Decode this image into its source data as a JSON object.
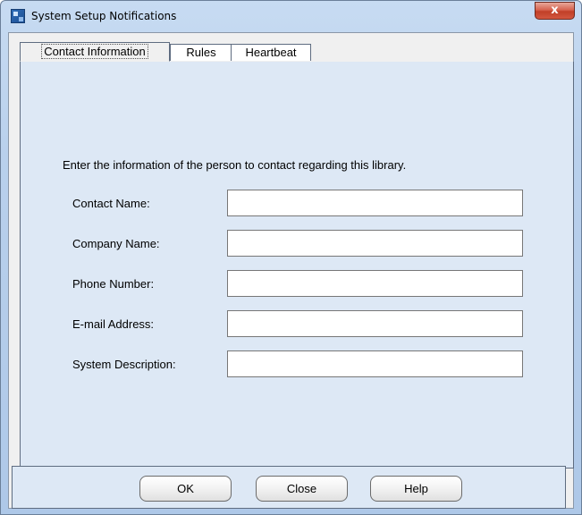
{
  "window": {
    "title": "System Setup Notifications",
    "close_glyph": "x",
    "icon": "app-icon",
    "colors": {
      "frame": "#b9d0ec",
      "panel": "#dde8f5",
      "close_button": "#c13f28"
    }
  },
  "tabs": [
    {
      "label": "Contact Information",
      "active": true
    },
    {
      "label": "Rules",
      "active": false
    },
    {
      "label": "Heartbeat",
      "active": false
    }
  ],
  "form": {
    "intro": "Enter the information of the person to contact regarding this library.",
    "fields": [
      {
        "label": "Contact Name:",
        "value": ""
      },
      {
        "label": "Company Name:",
        "value": ""
      },
      {
        "label": "Phone Number:",
        "value": ""
      },
      {
        "label": "E-mail Address:",
        "value": ""
      },
      {
        "label": "System Description:",
        "value": ""
      }
    ]
  },
  "buttons": {
    "ok": "OK",
    "close": "Close",
    "help": "Help"
  }
}
